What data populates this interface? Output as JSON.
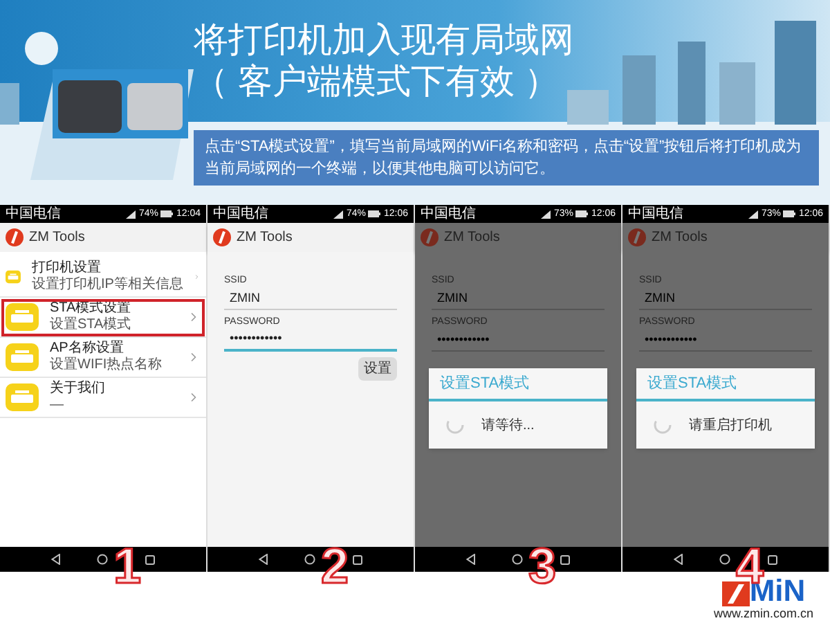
{
  "title": [
    "将打印机加入现有局域网",
    "（ 客户端模式下有效 ）"
  ],
  "description": "点击“STA模式设置”，填写当前局域网的WiFi名称和密码，点击“设置”按钮后将打印机成为当前局域网的一个终端，以便其他电脑可以访问它。",
  "phones": [
    {
      "kind": "menu",
      "status": {
        "carrier": "中国电信",
        "battery": "74%",
        "time": "12:04"
      },
      "app_title": "ZM Tools",
      "step": "1",
      "items": [
        {
          "title": "打印机设置",
          "subtitle": "设置打印机IP等相关信息",
          "selected": false
        },
        {
          "title": "STA模式设置",
          "subtitle": "设置STA模式",
          "selected": true
        },
        {
          "title": "AP名称设置",
          "subtitle": "设置WIFI热点名称",
          "selected": false
        },
        {
          "title": "关于我们",
          "subtitle": "—",
          "selected": false
        }
      ]
    },
    {
      "kind": "form",
      "status": {
        "carrier": "中国电信",
        "battery": "74%",
        "time": "12:06"
      },
      "app_title": "ZM Tools",
      "step": "2",
      "fields": [
        {
          "label": "SSID",
          "value": "ZMIN",
          "focused": false
        },
        {
          "label": "PASSWORD",
          "value": "••••••••••••",
          "focused": true
        }
      ],
      "button": "设置"
    },
    {
      "kind": "dialog",
      "status": {
        "carrier": "中国电信",
        "battery": "73%",
        "time": "12:06"
      },
      "app_title": "ZM Tools",
      "step": "3",
      "fields": [
        {
          "label": "SSID",
          "value": "ZMIN",
          "focused": false
        },
        {
          "label": "PASSWORD",
          "value": "••••••••••••",
          "focused": false
        }
      ],
      "dialog": {
        "title": "设置STA模式",
        "message": "请等待..."
      }
    },
    {
      "kind": "dialog",
      "status": {
        "carrier": "中国电信",
        "battery": "73%",
        "time": "12:06"
      },
      "app_title": "ZM Tools",
      "step": "4",
      "fields": [
        {
          "label": "SSID",
          "value": "ZMIN",
          "focused": false
        },
        {
          "label": "PASSWORD",
          "value": "••••••••••••",
          "focused": false
        }
      ],
      "dialog": {
        "title": "设置STA模式",
        "message": "请重启打印机"
      }
    }
  ],
  "logo": {
    "text": "MiN",
    "url": "www.zmin.com.cn"
  }
}
